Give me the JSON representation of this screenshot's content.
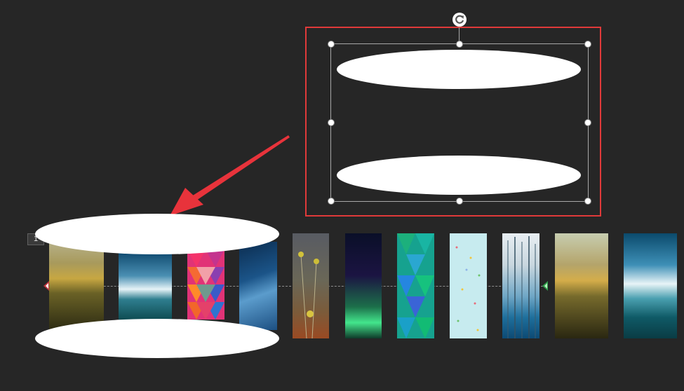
{
  "slide": {
    "number": "1"
  },
  "icons": {
    "rotate": "rotate-handle-icon",
    "guide_left": "guide-marker-left-icon",
    "guide_right": "guide-marker-right-icon"
  },
  "colors": {
    "background": "#262626",
    "selection_outline": "#e03a3a",
    "arrow": "#e8333b",
    "shape_fill": "#ffffff"
  }
}
